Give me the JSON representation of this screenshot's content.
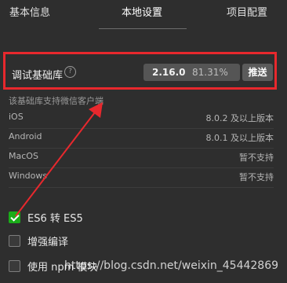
{
  "tabs": [
    {
      "label": "基本信息"
    },
    {
      "label": "本地设置"
    },
    {
      "label": "项目配置"
    }
  ],
  "debug_lib": {
    "label": "调试基础库",
    "help_icon": "question-circle-icon",
    "version": "2.16.0",
    "percent": "81.31%",
    "push_label": "推送"
  },
  "support_note": "该基础库支持微信客户端",
  "platforms": [
    {
      "name": "iOS",
      "value": "8.0.2 及以上版本"
    },
    {
      "name": "Android",
      "value": "8.0.1 及以上版本"
    },
    {
      "name": "MacOS",
      "value": "暂不支持"
    },
    {
      "name": "Windows",
      "value": "暂不支持"
    }
  ],
  "options": [
    {
      "label": "ES6 转 ES5",
      "checked": true
    },
    {
      "label": "增强编译",
      "checked": false
    },
    {
      "label": "使用 npm 模块",
      "checked": false
    }
  ],
  "watermark": "https://blog.csdn.net/weixin_45442869",
  "colors": {
    "highlight": "#e8282d",
    "check_green": "#1aad19"
  }
}
